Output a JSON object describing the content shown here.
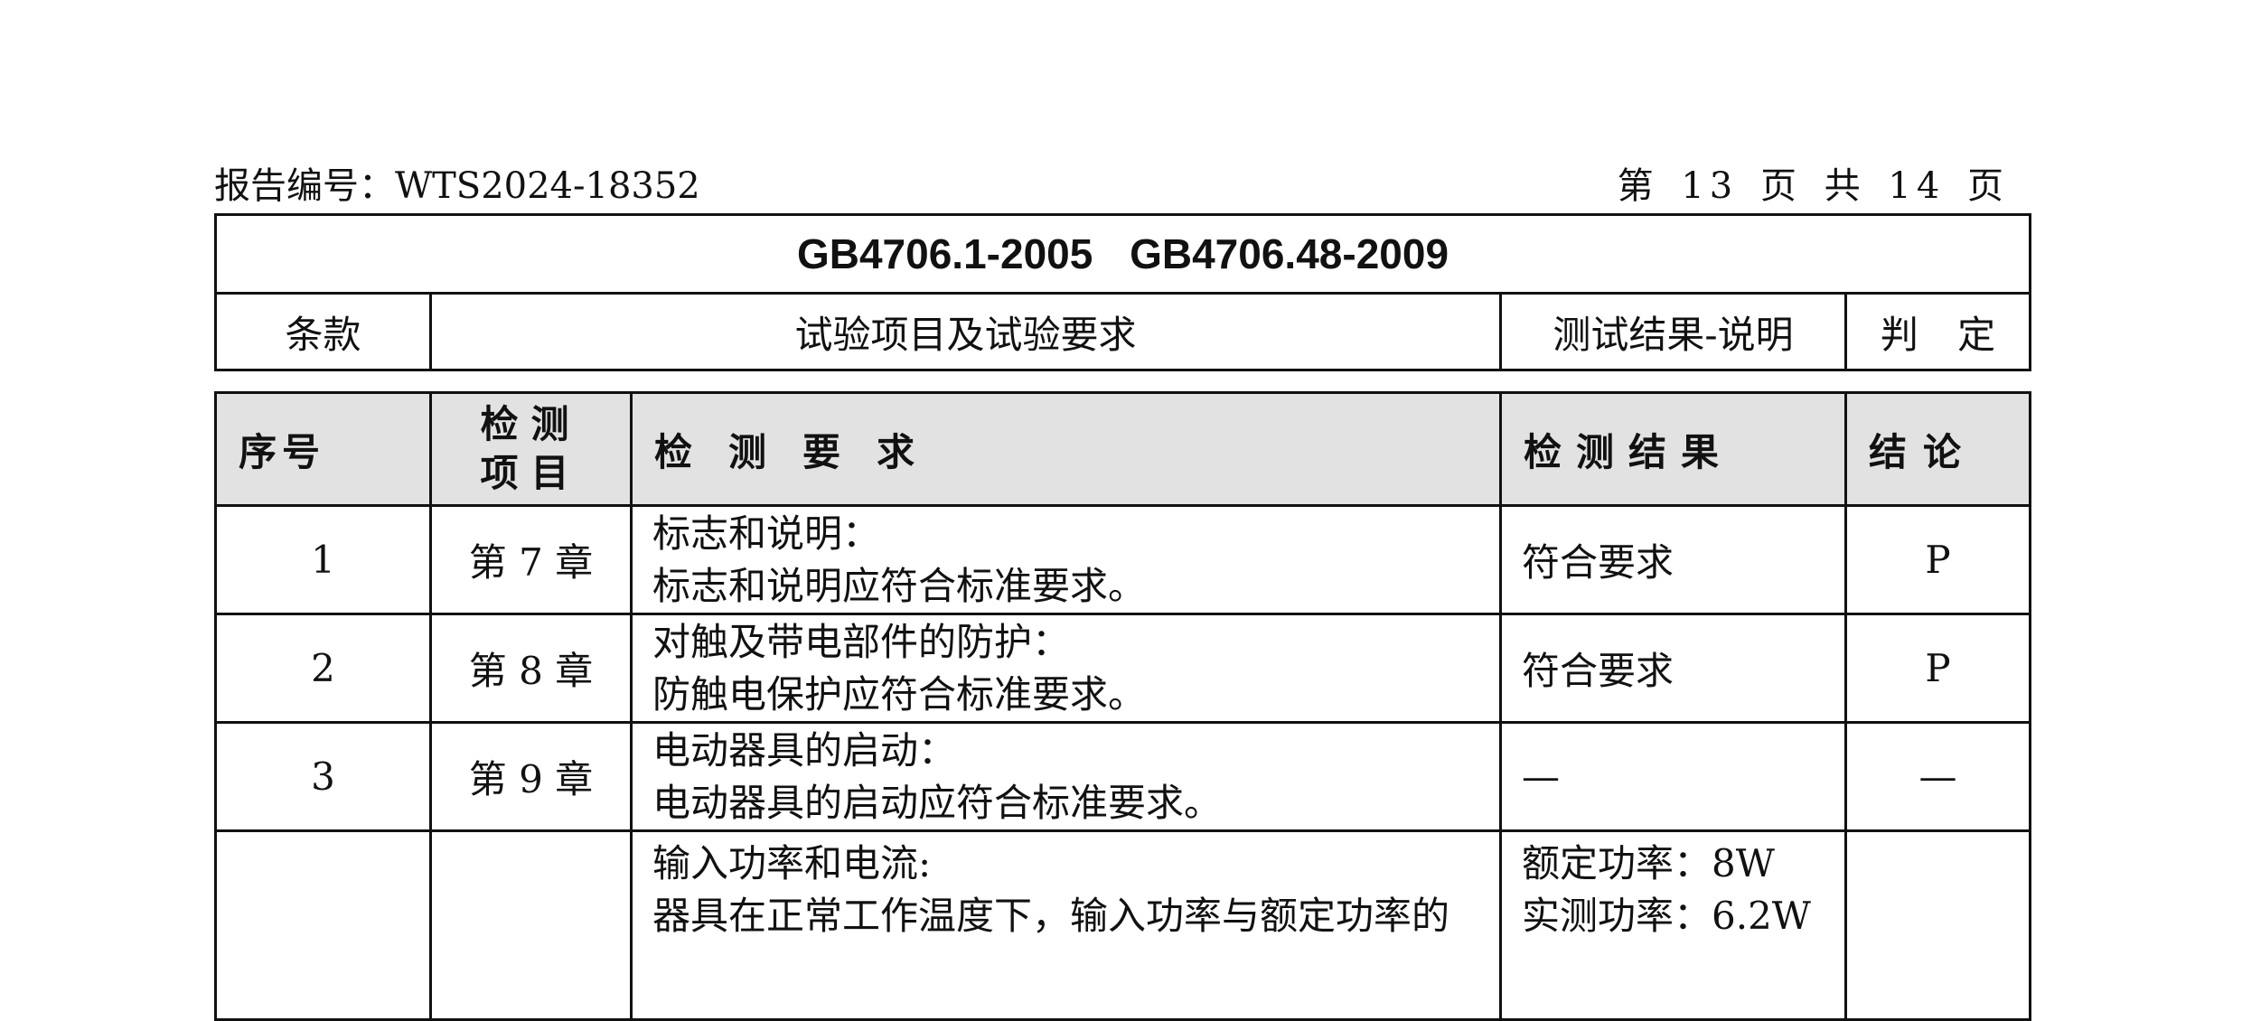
{
  "header": {
    "report_number": "报告编号：WTS2024-18352",
    "page_info": "第 13 页 共 14 页"
  },
  "standard_table": {
    "title": "GB4706.1-2005 GB4706.48-2009",
    "columns": [
      "条款",
      "试验项目及试验要求",
      "测试结果-说明",
      "判 定"
    ]
  },
  "detection_table": {
    "headers": {
      "seq": "序号",
      "item_line1": "检测",
      "item_line2": "项目",
      "requirement": "检测要求",
      "result": "检测结果",
      "conclusion": "结论"
    },
    "rows": [
      {
        "seq": "1",
        "chapter": "第 7 章",
        "req_title": "标志和说明：",
        "req_text": "标志和说明应符合标准要求。",
        "result": "符合要求",
        "verdict": "P"
      },
      {
        "seq": "2",
        "chapter": "第 8 章",
        "req_title": "对触及带电部件的防护：",
        "req_text": "防触电保护应符合标准要求。",
        "result": "符合要求",
        "verdict": "P"
      },
      {
        "seq": "3",
        "chapter": "第 9 章",
        "req_title": "电动器具的启动：",
        "req_text": "电动器具的启动应符合标准要求。",
        "result": "—",
        "verdict": "—"
      },
      {
        "seq": "",
        "chapter": "",
        "req_title": "输入功率和电流:",
        "req_text": "器具在正常工作温度下，输入功率与额定功率的",
        "result_line1": "额定功率：8W",
        "result_line2": "实测功率：6.2W",
        "verdict": ""
      }
    ]
  }
}
